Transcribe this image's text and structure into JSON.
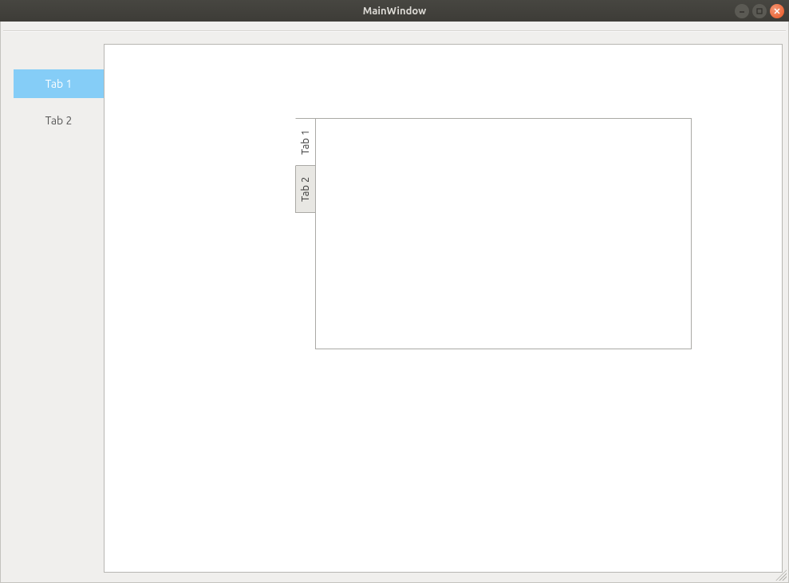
{
  "window": {
    "title": "MainWindow"
  },
  "outer_tabs": {
    "items": [
      {
        "label": "Tab 1"
      },
      {
        "label": "Tab 2"
      }
    ],
    "active_index": 0
  },
  "inner_tabs": {
    "items": [
      {
        "label": "Tab 1"
      },
      {
        "label": "Tab 2"
      }
    ],
    "active_index": 0
  }
}
